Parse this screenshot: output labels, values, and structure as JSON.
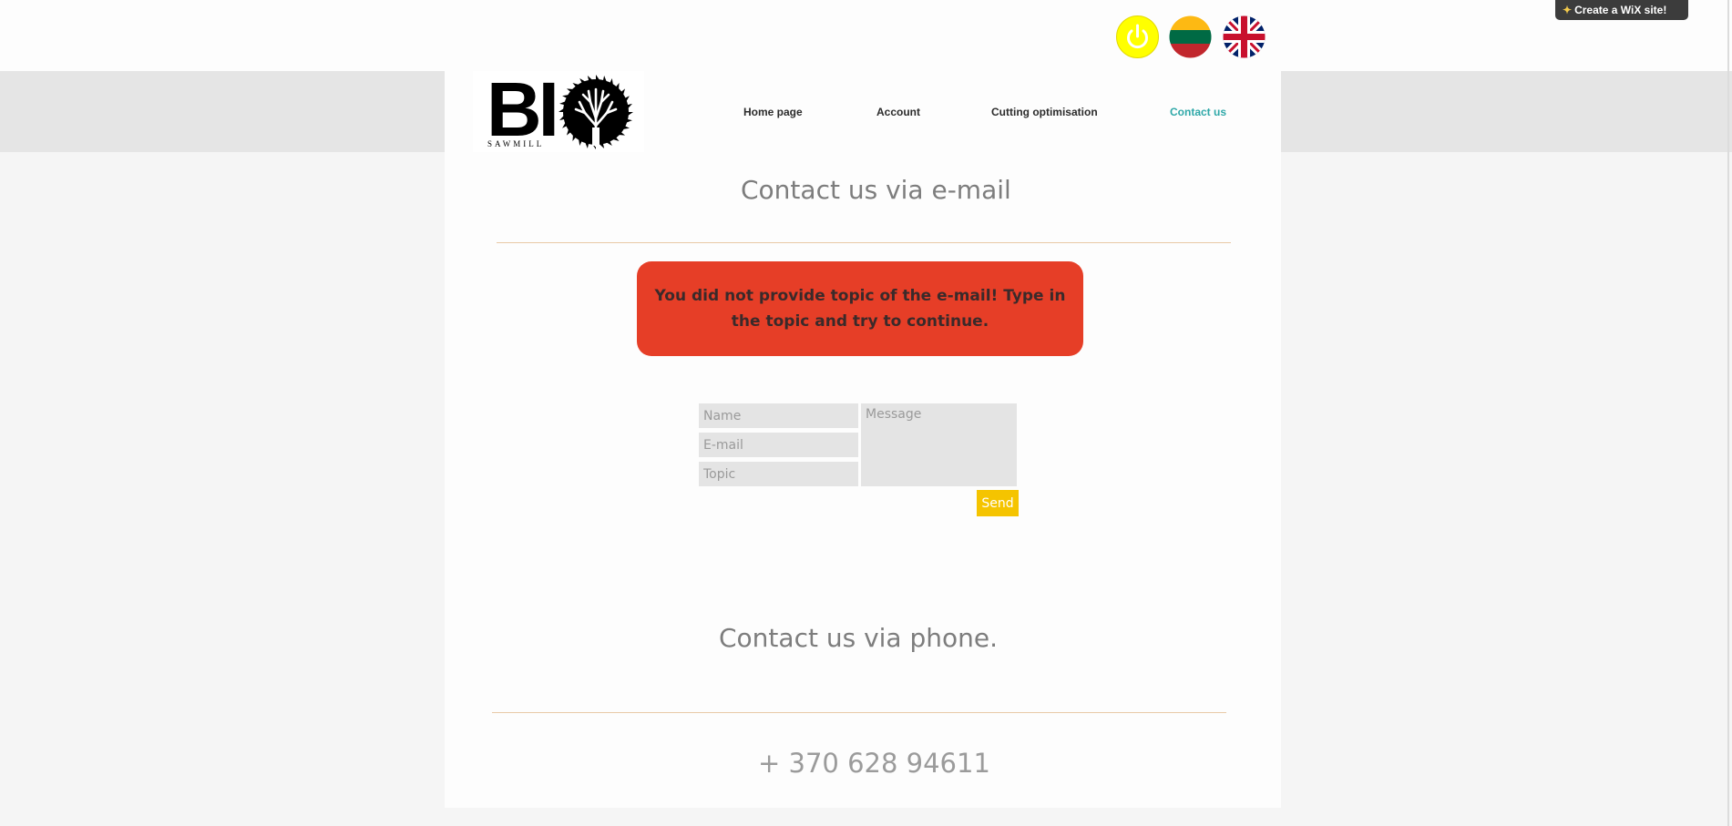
{
  "wix_badge": {
    "label": "Create a WiX site!"
  },
  "languages": {
    "items": [
      {
        "name": "power-icon",
        "color": "#ffff00"
      },
      {
        "name": "lithuanian-flag-icon",
        "colors": [
          "#fdb913",
          "#006a44",
          "#c1272d"
        ]
      },
      {
        "name": "uk-flag-icon",
        "colors": [
          "#012169",
          "#ffffff",
          "#c8102e"
        ]
      }
    ]
  },
  "logo": {
    "title": "BI",
    "subtitle": "SAWMILL"
  },
  "nav": {
    "items": [
      {
        "label": "Home page"
      },
      {
        "label": "Account"
      },
      {
        "label": "Cutting optimisation"
      },
      {
        "label": "Contact us"
      }
    ],
    "active_label": "Contact us",
    "active_color": "#2fa8a8"
  },
  "email_section": {
    "title": "Contact us via e-mail",
    "error": "You did not provide topic of the e-mail! Type in the topic and try to continue.",
    "error_color": "#e63e27",
    "form": {
      "name_placeholder": "Name",
      "email_placeholder": "E-mail",
      "topic_placeholder": "Topic",
      "message_placeholder": "Message",
      "send_label": "Send",
      "send_color": "#f5c400"
    }
  },
  "phone_section": {
    "title": "Contact us via phone.",
    "phone": "+ 370 628 94611"
  }
}
